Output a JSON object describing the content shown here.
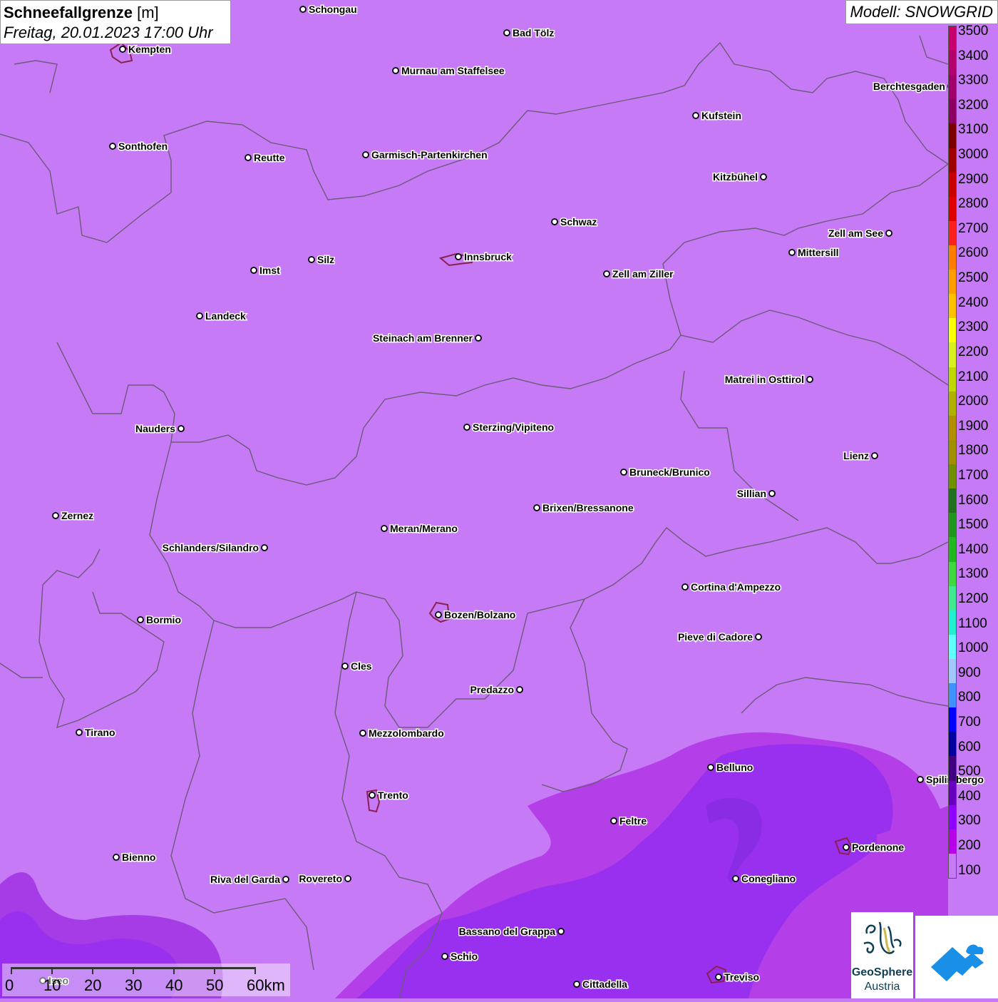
{
  "header": {
    "title_bold": "Schneefallgrenze",
    "title_unit": "[m]",
    "datetime": "Freitag, 20.01.2023 17:00 Uhr"
  },
  "model_label": "Modell: SNOWGRID",
  "legend": {
    "labels": [
      "3500",
      "3400",
      "3300",
      "3200",
      "3100",
      "3000",
      "2900",
      "2800",
      "2700",
      "2600",
      "2500",
      "2400",
      "2300",
      "2200",
      "2100",
      "2000",
      "1900",
      "1800",
      "1700",
      "1600",
      "1500",
      "1400",
      "1300",
      "1200",
      "1100",
      "1000",
      "900",
      "800",
      "700",
      "600",
      "500",
      "400",
      "300",
      "200",
      "100"
    ],
    "colors": [
      "#c8006e",
      "#b4006c",
      "#a0006a",
      "#8c0066",
      "#7a0000",
      "#a00000",
      "#c80000",
      "#e00000",
      "#ff2020",
      "#ff7d00",
      "#ff9e00",
      "#ffc000",
      "#ffff00",
      "#d8f020",
      "#c0d800",
      "#b0b000",
      "#b09000",
      "#a09000",
      "#709000",
      "#207020",
      "#209820",
      "#20b820",
      "#40d840",
      "#40e890",
      "#20f0d0",
      "#60ffff",
      "#a0c8ff",
      "#4090ff",
      "#0000ff",
      "#0000a0",
      "#400080",
      "#6800c0",
      "#9000ff",
      "#b800e8",
      "#c77af6"
    ]
  },
  "map_colors": {
    "base": "#c77af6",
    "zone_300": "#9d2cf0",
    "zone_200": "#b23ae8",
    "zone_400": "#8a2ee8",
    "border": "#6b5a7a",
    "city_outline": "#8b2050"
  },
  "cities": [
    {
      "name": "Schongau",
      "label_side": "right"
    },
    {
      "name": "Bad Tölz",
      "label_side": "right"
    },
    {
      "name": "Kempten",
      "label_side": "right"
    },
    {
      "name": "Murnau am Staffelsee",
      "label_side": "right"
    },
    {
      "name": "Berchtesgaden",
      "label_side": "left"
    },
    {
      "name": "Kufstein",
      "label_side": "right"
    },
    {
      "name": "Sonthofen",
      "label_side": "right"
    },
    {
      "name": "Reutte",
      "label_side": "right"
    },
    {
      "name": "Garmisch-Partenkirchen",
      "label_side": "right"
    },
    {
      "name": "Kitzbühel",
      "label_side": "left"
    },
    {
      "name": "Schwaz",
      "label_side": "right"
    },
    {
      "name": "Zell am See",
      "label_side": "left"
    },
    {
      "name": "Innsbruck",
      "label_side": "right"
    },
    {
      "name": "Mittersill",
      "label_side": "right"
    },
    {
      "name": "Imst",
      "label_side": "right"
    },
    {
      "name": "Silz",
      "label_side": "right"
    },
    {
      "name": "Zell am Ziller",
      "label_side": "right"
    },
    {
      "name": "Landeck",
      "label_side": "right"
    },
    {
      "name": "Steinach am Brenner",
      "label_side": "left"
    },
    {
      "name": "Matrei in Osttirol",
      "label_side": "left"
    },
    {
      "name": "Nauders",
      "label_side": "left"
    },
    {
      "name": "Sterzing/Vipiteno",
      "label_side": "right"
    },
    {
      "name": "Lienz",
      "label_side": "left"
    },
    {
      "name": "Bruneck/Brunico",
      "label_side": "right"
    },
    {
      "name": "Sillian",
      "label_side": "left"
    },
    {
      "name": "Zernez",
      "label_side": "right"
    },
    {
      "name": "Brixen/Bressanone",
      "label_side": "right"
    },
    {
      "name": "Meran/Merano",
      "label_side": "right"
    },
    {
      "name": "Schlanders/Silandro",
      "label_side": "left"
    },
    {
      "name": "Cortina d'Ampezzo",
      "label_side": "right"
    },
    {
      "name": "Bozen/Bolzano",
      "label_side": "right"
    },
    {
      "name": "Bormio",
      "label_side": "right"
    },
    {
      "name": "Pieve di Cadore",
      "label_side": "left"
    },
    {
      "name": "Cles",
      "label_side": "right"
    },
    {
      "name": "Predazzo",
      "label_side": "left"
    },
    {
      "name": "Tirano",
      "label_side": "right"
    },
    {
      "name": "Mezzolombardo",
      "label_side": "right"
    },
    {
      "name": "Belluno",
      "label_side": "right"
    },
    {
      "name": "Spilimbergo",
      "label_side": "right"
    },
    {
      "name": "Trento",
      "label_side": "right"
    },
    {
      "name": "Feltre",
      "label_side": "right"
    },
    {
      "name": "Pordenone",
      "label_side": "right"
    },
    {
      "name": "Bienno",
      "label_side": "right"
    },
    {
      "name": "Riva del Garda",
      "label_side": "left"
    },
    {
      "name": "Rovereto",
      "label_side": "left"
    },
    {
      "name": "Conegliano",
      "label_side": "right"
    },
    {
      "name": "Bassano del Grappa",
      "label_side": "left"
    },
    {
      "name": "Schio",
      "label_side": "right"
    },
    {
      "name": "Treviso",
      "label_side": "right"
    },
    {
      "name": "Cittadella",
      "label_side": "right"
    },
    {
      "name": "Iseo",
      "label_side": "right"
    }
  ],
  "scale_bar": {
    "labels": [
      "0",
      "10",
      "20",
      "30",
      "40",
      "50",
      "60km"
    ]
  },
  "logos": {
    "geosphere_line1": "GeoSphere",
    "geosphere_line2": "Austria"
  }
}
